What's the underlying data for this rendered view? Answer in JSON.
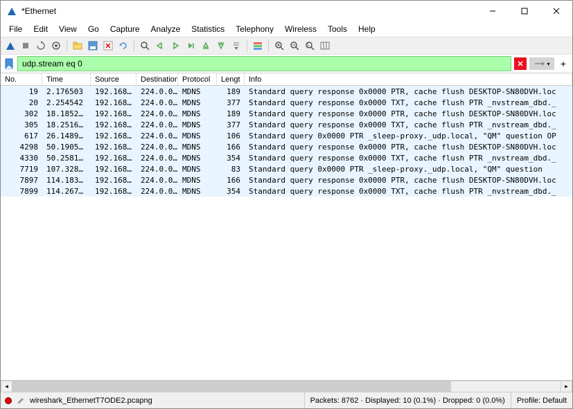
{
  "window": {
    "title": "*Ethernet"
  },
  "menu": {
    "file": "File",
    "edit": "Edit",
    "view": "View",
    "go": "Go",
    "capture": "Capture",
    "analyze": "Analyze",
    "statistics": "Statistics",
    "telephony": "Telephony",
    "wireless": "Wireless",
    "tools": "Tools",
    "help": "Help"
  },
  "filter": {
    "value": "udp.stream eq 0",
    "clear": "✕",
    "arrow_label": "→",
    "plus": "+"
  },
  "columns": {
    "no": "No.",
    "time": "Time",
    "source": "Source",
    "destination": "Destination",
    "protocol": "Protocol",
    "length": "Lengt",
    "info": "Info"
  },
  "packets": [
    {
      "no": "19",
      "time": "2.176503",
      "src": "192.168…",
      "dst": "224.0.0…",
      "proto": "MDNS",
      "len": "189",
      "info": "Standard query response 0x0000 PTR, cache flush DESKTOP-SN80DVH.loc"
    },
    {
      "no": "20",
      "time": "2.254542",
      "src": "192.168…",
      "dst": "224.0.0…",
      "proto": "MDNS",
      "len": "377",
      "info": "Standard query response 0x0000 TXT, cache flush PTR _nvstream_dbd._"
    },
    {
      "no": "302",
      "time": "18.1852…",
      "src": "192.168…",
      "dst": "224.0.0…",
      "proto": "MDNS",
      "len": "189",
      "info": "Standard query response 0x0000 PTR, cache flush DESKTOP-SN80DVH.loc"
    },
    {
      "no": "305",
      "time": "18.2516…",
      "src": "192.168…",
      "dst": "224.0.0…",
      "proto": "MDNS",
      "len": "377",
      "info": "Standard query response 0x0000 TXT, cache flush PTR _nvstream_dbd._"
    },
    {
      "no": "617",
      "time": "26.1489…",
      "src": "192.168…",
      "dst": "224.0.0…",
      "proto": "MDNS",
      "len": "106",
      "info": "Standard query 0x0000 PTR _sleep-proxy._udp.local, \"QM\" question OP"
    },
    {
      "no": "4298",
      "time": "50.1905…",
      "src": "192.168…",
      "dst": "224.0.0…",
      "proto": "MDNS",
      "len": "166",
      "info": "Standard query response 0x0000 PTR, cache flush DESKTOP-SN80DVH.loc"
    },
    {
      "no": "4330",
      "time": "50.2581…",
      "src": "192.168…",
      "dst": "224.0.0…",
      "proto": "MDNS",
      "len": "354",
      "info": "Standard query response 0x0000 TXT, cache flush PTR _nvstream_dbd._"
    },
    {
      "no": "7719",
      "time": "107.328…",
      "src": "192.168…",
      "dst": "224.0.0…",
      "proto": "MDNS",
      "len": "83",
      "info": "Standard query 0x0000 PTR _sleep-proxy._udp.local, \"QM\" question"
    },
    {
      "no": "7897",
      "time": "114.183…",
      "src": "192.168…",
      "dst": "224.0.0…",
      "proto": "MDNS",
      "len": "166",
      "info": "Standard query response 0x0000 PTR, cache flush DESKTOP-SN80DVH.loc"
    },
    {
      "no": "7899",
      "time": "114.267…",
      "src": "192.168…",
      "dst": "224.0.0…",
      "proto": "MDNS",
      "len": "354",
      "info": "Standard query response 0x0000 TXT, cache flush PTR _nvstream_dbd._"
    }
  ],
  "status": {
    "file": "wireshark_EthernetT7ODE2.pcapng",
    "stats": "Packets: 8762 · Displayed: 10 (0.1%) · Dropped: 0 (0.0%)",
    "profile": "Profile: Default"
  }
}
